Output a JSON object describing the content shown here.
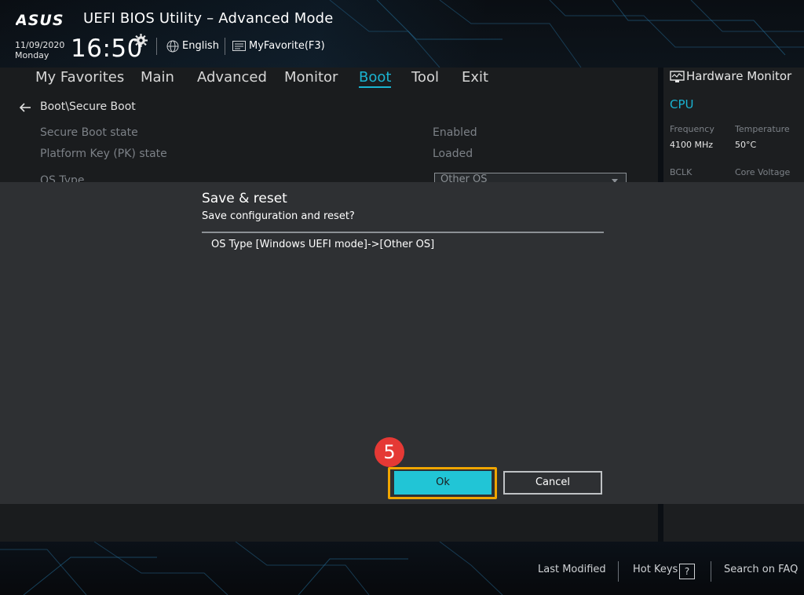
{
  "header": {
    "brand": "ASUS",
    "title": "UEFI BIOS Utility – Advanced Mode",
    "date": "11/09/2020",
    "weekday": "Monday",
    "time": "16:50",
    "language": "English",
    "my_favorite": "MyFavorite(F3)"
  },
  "tabs": [
    {
      "label": "My Favorites",
      "active": false
    },
    {
      "label": "Main",
      "active": false
    },
    {
      "label": "Advanced",
      "active": false
    },
    {
      "label": "Monitor",
      "active": false
    },
    {
      "label": "Boot",
      "active": true
    },
    {
      "label": "Tool",
      "active": false
    },
    {
      "label": "Exit",
      "active": false
    }
  ],
  "main": {
    "breadcrumb": "Boot\\Secure Boot",
    "rows": [
      {
        "label": "Secure Boot state",
        "value": "Enabled"
      },
      {
        "label": "Platform Key (PK) state",
        "value": "Loaded"
      },
      {
        "label": "OS Type",
        "value": "Other OS"
      }
    ]
  },
  "hardware_monitor": {
    "title": "Hardware Monitor",
    "section": "CPU",
    "frequency_label": "Frequency",
    "frequency_value": "4100 MHz",
    "temperature_label": "Temperature",
    "temperature_value": "50°C",
    "bclk_label": "BCLK",
    "core_voltage_label": "Core Voltage"
  },
  "dialog": {
    "title": "Save & reset",
    "subtitle": "Save configuration and reset?",
    "change": "OS Type [Windows UEFI mode]->[Other OS]",
    "ok_label": "Ok",
    "cancel_label": "Cancel",
    "step_badge": "5"
  },
  "footer": {
    "last_modified": "Last Modified",
    "hot_keys": "Hot Keys",
    "hot_keys_icon": "?",
    "search_faq": "Search on FAQ"
  },
  "colors": {
    "accent": "#1ab3d1",
    "ok_button": "#21c5d6",
    "highlight": "#f0a500",
    "step_badge": "#e53935"
  }
}
